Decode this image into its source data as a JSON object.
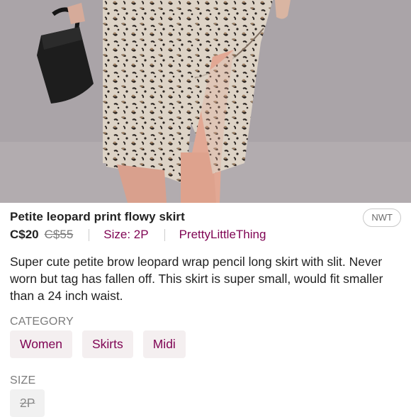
{
  "listing": {
    "title": "Petite leopard print flowy skirt",
    "condition_badge": "NWT",
    "price": "C$20",
    "original_price": "C$55",
    "size": "Size: 2P",
    "brand": "PrettyLittleThing",
    "description": "Super cute petite brow leopard wrap pencil long skirt with slit. Never worn but tag has fallen off. This skirt is super small, would fit smaller than a 24 inch waist."
  },
  "category": {
    "heading": "CATEGORY",
    "chips": [
      "Women",
      "Skirts",
      "Midi"
    ]
  },
  "size_section": {
    "heading": "SIZE",
    "value": "2P"
  },
  "colors": {
    "accent": "#7f0353",
    "chip_bg": "#f4eff0",
    "muted_text": "#7c7c7c"
  }
}
